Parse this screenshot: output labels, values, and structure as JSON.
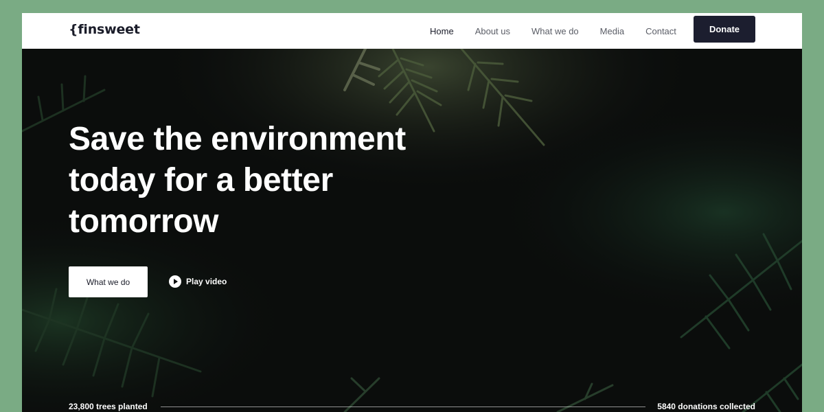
{
  "brand": {
    "logo_text": "{finsweet"
  },
  "nav": {
    "items": [
      {
        "label": "Home",
        "active": true
      },
      {
        "label": "About us",
        "active": false
      },
      {
        "label": "What we do",
        "active": false
      },
      {
        "label": "Media",
        "active": false
      },
      {
        "label": "Contact",
        "active": false
      }
    ],
    "donate_label": "Donate"
  },
  "hero": {
    "headline_lines": [
      "Save the environment",
      "today for a better",
      "tomorrow"
    ],
    "primary_button": "What we do",
    "video_link": "Play video",
    "stats": {
      "left": "23,800 trees planted",
      "right": "5840 donations collected"
    }
  },
  "colors": {
    "page_bg": "#7aab84",
    "nav_bg": "#ffffff",
    "donate_bg": "#1c1e2f",
    "hero_bg": "#0b0d0c",
    "text_light": "#ffffff"
  }
}
